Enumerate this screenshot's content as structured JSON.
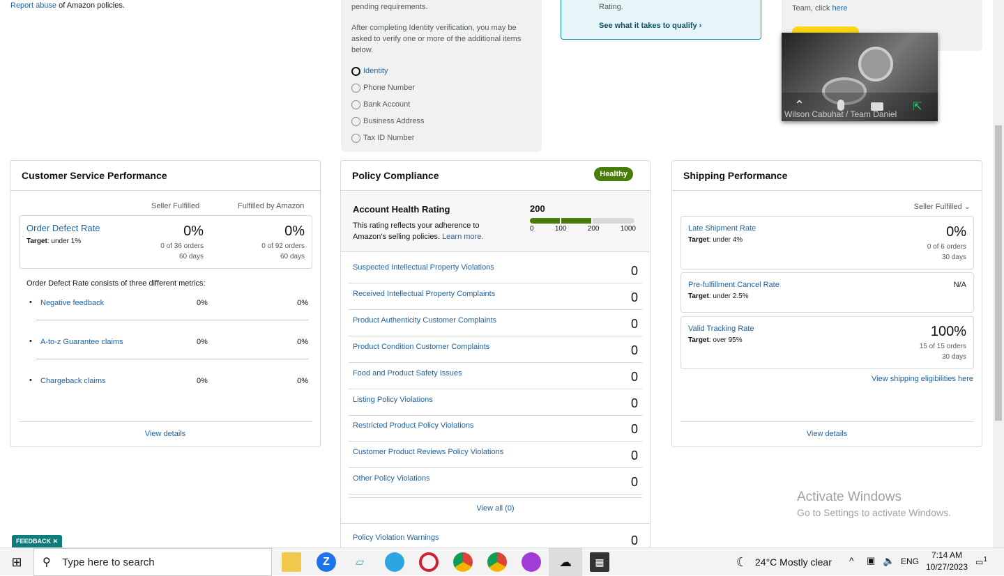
{
  "top": {
    "report_abuse": "Report abuse",
    "policies_text": "of Amazon policies.",
    "verify_text1": "pending requirements.",
    "verify_text2": "After completing Identity verification, you may be asked to verify one or more of the additional items below.",
    "radio_items": [
      "Identity",
      "Phone Number",
      "Bank Account",
      "Business Address",
      "Tax ID Number"
    ],
    "rating_text": "Rating.",
    "qualify_link": "See what it takes to qualify",
    "team_text": "Team, click",
    "here_link": "here"
  },
  "video": {
    "name": "Wilson Cabuhat / Team Daniel"
  },
  "cs": {
    "title": "Customer Service Performance",
    "col1": "Seller Fulfilled",
    "col2": "Fulfilled by Amazon",
    "odr_label": "Order Defect Rate",
    "target_label": "Target",
    "target_val": ": under 1%",
    "v1": "0%",
    "s1": "0 of 36 orders",
    "d1": "60 days",
    "v2": "0%",
    "s2": "0 of 92 orders",
    "d2": "60 days",
    "consists": "Order Defect Rate consists of three different metrics:",
    "metrics": [
      {
        "name": "Negative feedback",
        "a": "0%",
        "b": "0%"
      },
      {
        "name": "A-to-z Guarantee claims",
        "a": "0%",
        "b": "0%"
      },
      {
        "name": "Chargeback claims",
        "a": "0%",
        "b": "0%"
      }
    ],
    "view_details": "View details"
  },
  "pc": {
    "title": "Policy Compliance",
    "badge": "Healthy",
    "ahr_title": "Account Health Rating",
    "ahr_value": "200",
    "ahr_desc": "This rating reflects your adherence to Amazon's selling policies.",
    "learn_more": "Learn more.",
    "scale": [
      "0",
      "100",
      "200",
      "1000"
    ],
    "items": [
      {
        "name": "Suspected Intellectual Property Violations",
        "count": "0"
      },
      {
        "name": "Received Intellectual Property Complaints",
        "count": "0"
      },
      {
        "name": "Product Authenticity Customer Complaints",
        "count": "0"
      },
      {
        "name": "Product Condition Customer Complaints",
        "count": "0"
      },
      {
        "name": "Food and Product Safety Issues",
        "count": "0"
      },
      {
        "name": "Listing Policy Violations",
        "count": "0"
      },
      {
        "name": "Restricted Product Policy Violations",
        "count": "0"
      },
      {
        "name": "Customer Product Reviews Policy Violations",
        "count": "0"
      },
      {
        "name": "Other Policy Violations",
        "count": "0"
      }
    ],
    "view_all": "View all (0)",
    "warnings": "Policy Violation Warnings",
    "warnings_count": "0"
  },
  "sp": {
    "title": "Shipping Performance",
    "filter": "Seller Fulfilled",
    "late": {
      "label": "Late Shipment Rate",
      "target": ": under 4%",
      "val": "0%",
      "sub": "0 of 6 orders",
      "days": "30 days"
    },
    "cancel": {
      "label": "Pre-fulfillment Cancel Rate",
      "target": ": under 2.5%",
      "val": "N/A"
    },
    "tracking": {
      "label": "Valid Tracking Rate",
      "target": ": over 95%",
      "val": "100%",
      "sub": "15 of 15 orders",
      "days": "30 days"
    },
    "target_word": "Target",
    "eligibility": "View shipping eligibilities here",
    "view_details": "View details"
  },
  "activate": {
    "title": "Activate Windows",
    "sub": "Go to Settings to activate Windows."
  },
  "feedback": "FEEDBACK",
  "taskbar": {
    "search": "Type here to search",
    "weather": "24°C  Mostly clear",
    "lang": "ENG",
    "time": "7:14 AM",
    "date": "10/27/2023",
    "notif": "1"
  },
  "colors": {
    "green": "#4a7c0b",
    "teal_border": "#0c8fa3",
    "link": "#2162a1"
  }
}
